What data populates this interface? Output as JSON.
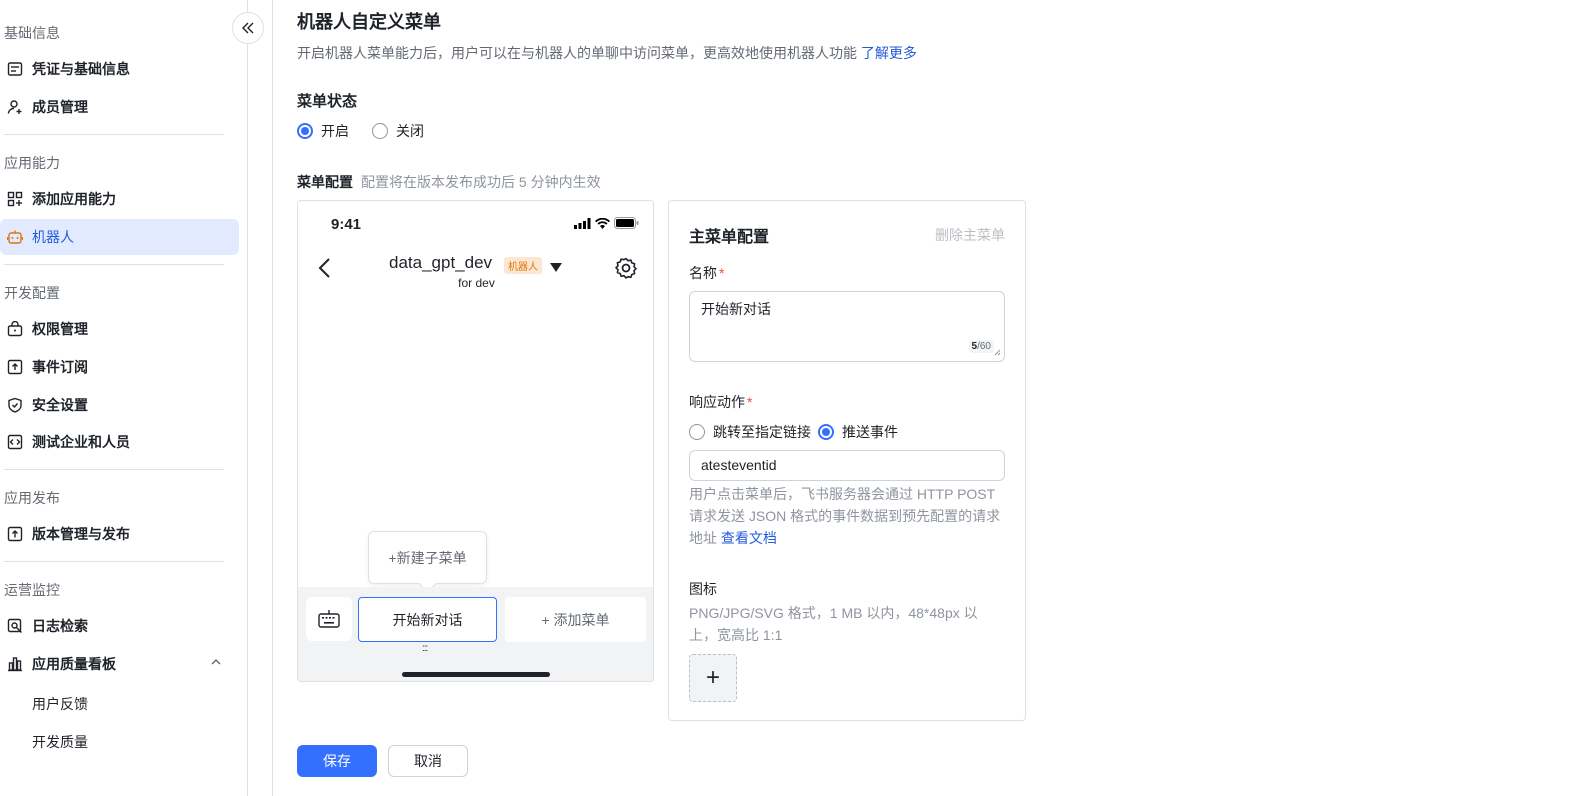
{
  "sidebar": {
    "collapse_icon": "double-chevron-left-icon",
    "groups": [
      {
        "title": "基础信息",
        "items": [
          {
            "label": "凭证与基础信息",
            "icon": "credential-icon"
          },
          {
            "label": "成员管理",
            "icon": "user-add-icon"
          }
        ]
      },
      {
        "title": "应用能力",
        "items": [
          {
            "label": "添加应用能力",
            "icon": "app-add-icon"
          },
          {
            "label": "机器人",
            "icon": "robot-icon",
            "active": true
          }
        ]
      },
      {
        "title": "开发配置",
        "items": [
          {
            "label": "权限管理",
            "icon": "lock-bag-icon"
          },
          {
            "label": "事件订阅",
            "icon": "event-icon"
          },
          {
            "label": "安全设置",
            "icon": "shield-icon"
          },
          {
            "label": "测试企业和人员",
            "icon": "code-icon"
          }
        ]
      },
      {
        "title": "应用发布",
        "items": [
          {
            "label": "版本管理与发布",
            "icon": "upload-icon"
          }
        ]
      },
      {
        "title": "运营监控",
        "items": [
          {
            "label": "日志检索",
            "icon": "log-search-icon"
          },
          {
            "label": "应用质量看板",
            "icon": "chart-icon",
            "expanded": true
          }
        ],
        "subitems": [
          "用户反馈",
          "开发质量"
        ]
      }
    ]
  },
  "main": {
    "title": "机器人自定义菜单",
    "description": "开启机器人菜单能力后，用户可以在与机器人的单聊中访问菜单，更高效地使用机器人功能",
    "learn_more": "了解更多",
    "menu_status_label": "菜单状态",
    "status_options": [
      {
        "label": "开启",
        "checked": true
      },
      {
        "label": "关闭",
        "checked": false
      }
    ],
    "menu_config_label": "菜单配置",
    "menu_config_hint": "配置将在版本发布成功后 5 分钟内生效"
  },
  "phone": {
    "time": "9:41",
    "chat_name": "data_gpt_dev",
    "bot_tag": "机器人",
    "chat_sub": "for dev",
    "popover": "+新建子菜单",
    "menu_button": "开始新对话",
    "add_menu": "+ 添加菜单",
    "drag_handle": ":::",
    "accent": "#3370ff"
  },
  "panel": {
    "title": "主菜单配置",
    "delete": "删除主菜单",
    "name_label": "名称",
    "required": "*",
    "name_value": "开始新对话",
    "counter_current": "5",
    "counter_max": "/60",
    "action_label": "响应动作",
    "action_options": [
      {
        "label": "跳转至指定链接",
        "checked": false
      },
      {
        "label": "推送事件",
        "checked": true
      }
    ],
    "event_value": "atesteventid",
    "help_line1": "用户点击菜单后，飞书服务器会通过 HTTP POST",
    "help_line2": "请求发送 JSON 格式的事件数据到预先配置的请求",
    "help_line3": "地址 ",
    "help_link": "查看文档",
    "icon_label": "图标",
    "icon_hint1": "PNG/JPG/SVG 格式，1 MB 以内，48*48px 以",
    "icon_hint2": "上，宽高比 1:1",
    "upload_symbol": "+"
  },
  "footer": {
    "save": "保存",
    "cancel": "取消"
  }
}
